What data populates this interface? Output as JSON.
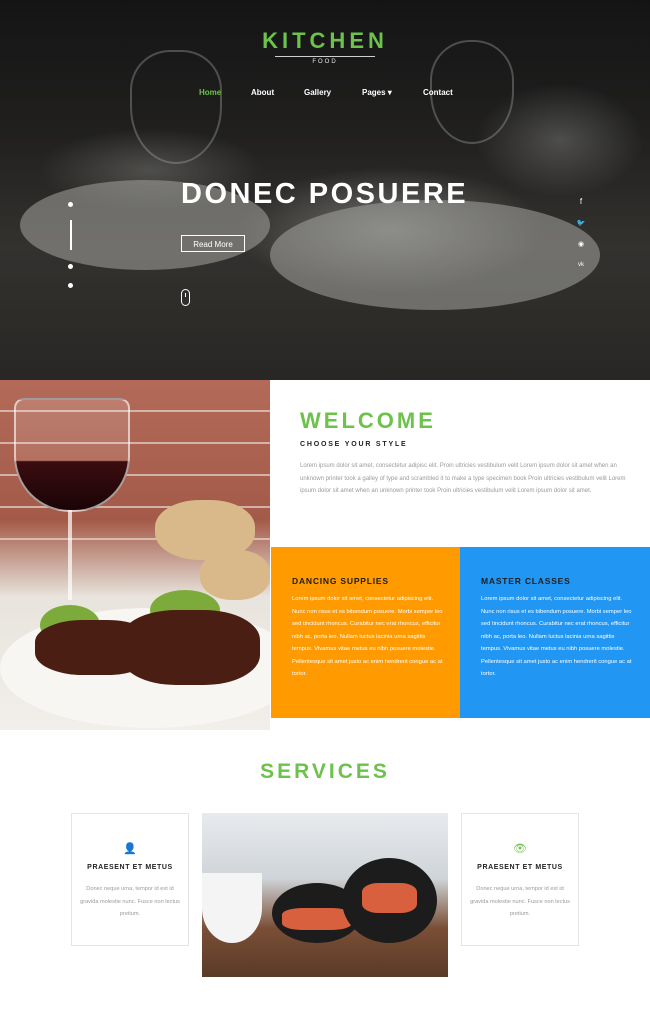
{
  "logo": {
    "title": "KITCHEN",
    "subtitle": "FOOD"
  },
  "nav": {
    "items": [
      {
        "label": "Home",
        "active": true
      },
      {
        "label": "About",
        "active": false
      },
      {
        "label": "Gallery",
        "active": false
      },
      {
        "label": "Pages ▾",
        "active": false
      },
      {
        "label": "Contact",
        "active": false
      }
    ]
  },
  "hero": {
    "title": "DONEC POSUERE",
    "button_label": "Read More",
    "social_icons": [
      "facebook-icon",
      "twitter-icon",
      "rss-icon",
      "vk-icon"
    ],
    "social_glyphs": [
      "f",
      "🐦",
      "◉",
      "vk"
    ]
  },
  "welcome": {
    "title": "WELCOME",
    "subtitle": "CHOOSE YOUR STYLE",
    "text": "Lorem ipsum dolor sit amet, consectetur adipisc elit. Proin ultricies vestibulum velit Lorem ipsum dolor sit amet when an unknown printer took a galley of type and scrambled it to make a type specimen book Proin ultricies vestibulum velit Lorem ipsum dolor sit amet when an unknown printer took Proin ultricies vestibulum velit Lorem ipsum dolor sit amet."
  },
  "boxes": [
    {
      "title": "DANCING SUPPLIES",
      "text": "Lorem ipsum dolor sit amet, consectetur adipiscing elit. Nunc non risus et es bibendum posuere. Morbi semper leo sed tincidunt rhoncus. Curabitur nec erat rhoncus, efficitur nibh ac, porta leo. Nullam luctus lacinia urna sagittis tempus. Vivamus vitae metus eu nibh posuere molestie. Pellentesque sit amet justo ac enim hendrerit congue ac at tortor."
    },
    {
      "title": "MASTER CLASSES",
      "text": "Lorem ipsum dolor sit amet, consectetur adipiscing elit. Nunc non risus et es bibendum posuere. Morbi semper leo sed tincidunt rhoncus. Curabitur nec erat rhoncus, efficitur nibh ac, porta leo. Nullam luctus lacinia urna sagittis tempus. Vivamus vitae metus eu nibh posuere molestie. Pellentesque sit amet justo ac enim hendrerit congue ac at tortor."
    }
  ],
  "services": {
    "title": "SERVICES",
    "cards": [
      {
        "icon": "user-icon",
        "glyph": "👤",
        "title": "PRAESENT ET METUS",
        "text": "Donec neque urna, tempor id est id gravida molestie nunc. Fusce non lectus pretium."
      },
      {
        "icon": "eye-icon",
        "glyph": "👁",
        "title": "PRAESENT ET METUS",
        "text": "Donec neque urna, tempor id est id gravida molestie nunc. Fusce non lectus pretium."
      }
    ]
  },
  "colors": {
    "accent": "#6cc24a",
    "orange": "#ff9a00",
    "blue": "#2196f3"
  }
}
